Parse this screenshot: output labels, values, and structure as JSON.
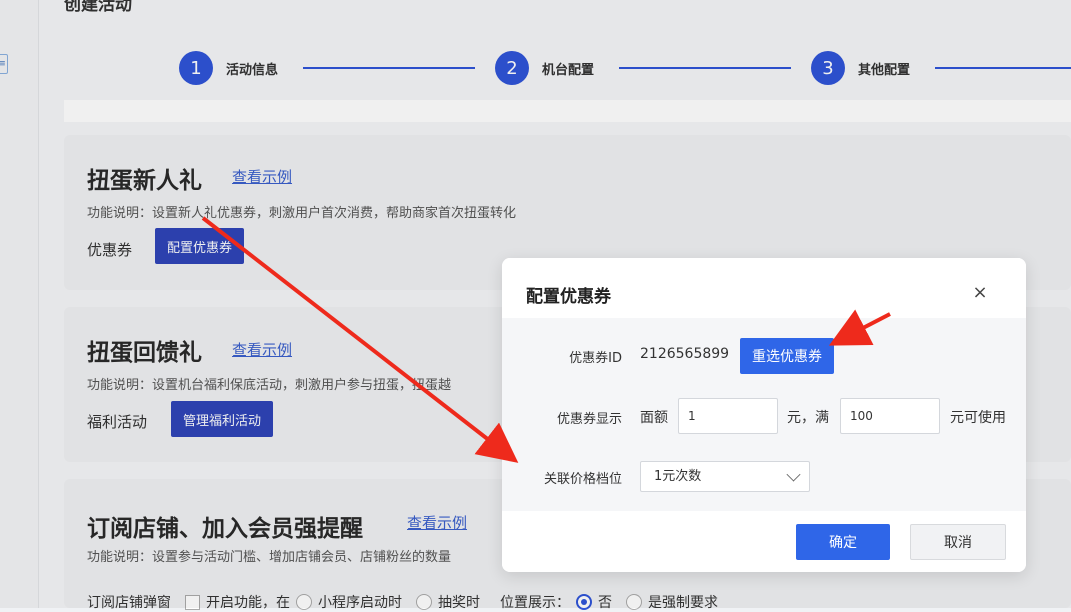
{
  "page": {
    "title": "创建活动",
    "sidebar_icon_text": "≡"
  },
  "steps": [
    {
      "number": "1",
      "label": "活动信息"
    },
    {
      "number": "2",
      "label": "机台配置"
    },
    {
      "number": "3",
      "label": "其他配置"
    }
  ],
  "cards": {
    "newcomer": {
      "title": "扭蛋新人礼",
      "link": "查看示例",
      "desc": "功能说明：设置新人礼优惠券，刺激用户首次消费，帮助商家首次扭蛋转化",
      "label": "优惠券",
      "button": "配置优惠券"
    },
    "feedback": {
      "title": "扭蛋回馈礼",
      "link": "查看示例",
      "desc": "功能说明：设置机台福利保底活动，刺激用户参与扭蛋，扭蛋越",
      "label": "福利活动",
      "button": "管理福利活动"
    },
    "subscribe": {
      "title": "订阅店铺、加入会员强提醒",
      "link": "查看示例",
      "desc": "功能说明：设置参与活动门槛、增加店铺会员、店铺粉丝的数量",
      "row": {
        "label": "订阅店铺弹窗",
        "enable": "开启功能，在",
        "opt1": "小程序启动时",
        "opt2": "抽奖时",
        "position_label": "位置展示：",
        "opt_no": "否",
        "opt_force": "是强制要求"
      }
    }
  },
  "modal": {
    "title": "配置优惠券",
    "close_icon": "×",
    "coupon_id_label": "优惠券ID",
    "coupon_id_value": "2126565899",
    "reselect_button": "重选优惠券",
    "display_label": "优惠券显示",
    "face_value_label": "面额",
    "face_value": "1",
    "unit_full": "元，满",
    "threshold": "100",
    "usable_suffix": "元可使用",
    "price_tier_label": "关联价格档位",
    "price_tier_value": "1元次数",
    "ok_button": "确定",
    "cancel_button": "取消"
  },
  "colors": {
    "primary": "#2f66e8",
    "step": "#2f54d8",
    "annotation_arrow": "#ee2a1c"
  }
}
